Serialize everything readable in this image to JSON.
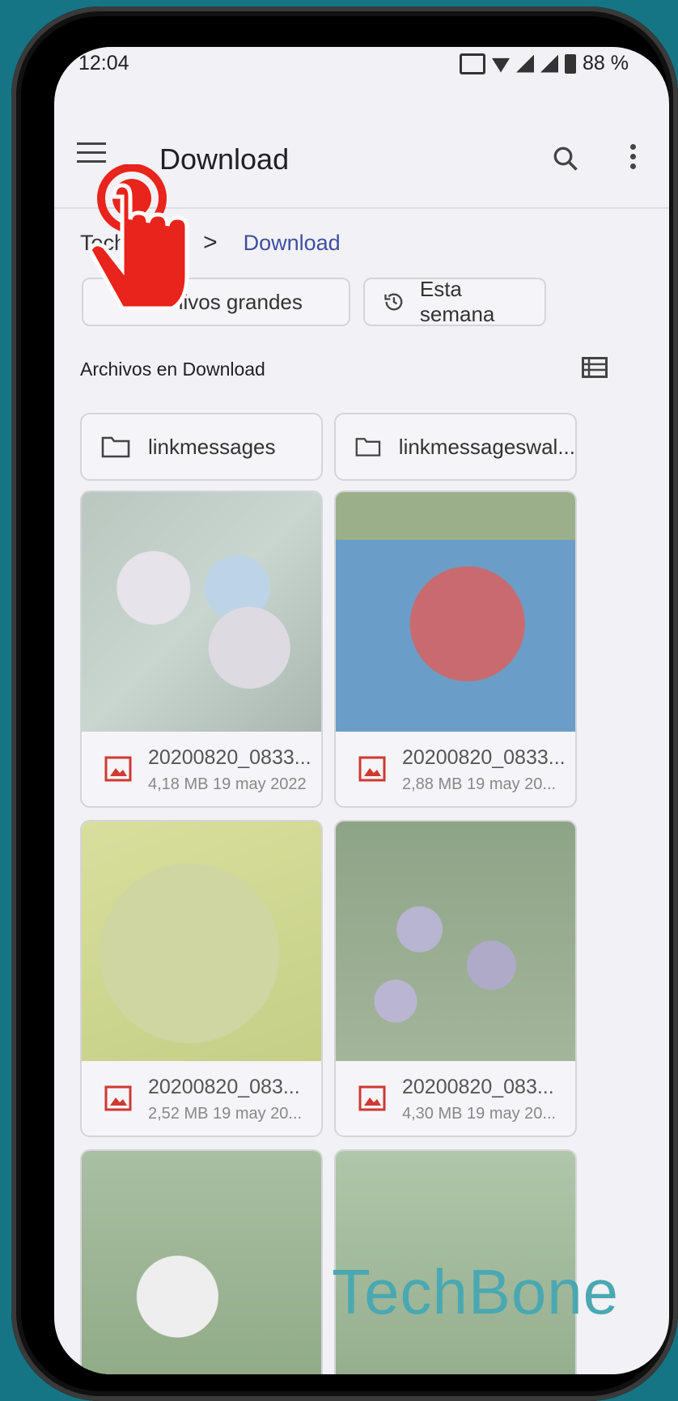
{
  "status_bar": {
    "time": "12:04",
    "battery": "88 %"
  },
  "app_bar": {
    "title": "Download"
  },
  "breadcrumb": {
    "root": "TechBone",
    "current": "Download",
    "separator": ">"
  },
  "chips": [
    {
      "label": "Archivos grandes"
    },
    {
      "label": "Esta semana"
    }
  ],
  "section": {
    "label": "Archivos en Download"
  },
  "folders": [
    {
      "name": "linkmessages"
    },
    {
      "name": "linkmessageswal..."
    }
  ],
  "files": [
    {
      "name": "20200820_0833...",
      "meta": "4,18 MB  19 may 2022"
    },
    {
      "name": "20200820_0833...",
      "meta": "2,88 MB  19 may 20..."
    },
    {
      "name": "20200820_083...",
      "meta": "2,52 MB  19 may 20..."
    },
    {
      "name": "20200820_083...",
      "meta": "4,30 MB  19 may 20..."
    }
  ],
  "watermark": "TechBone",
  "colors": {
    "accent": "#3f4fa0",
    "image_icon": "#d0392f",
    "tap_indicator": "#e8241c",
    "background": "#157585"
  }
}
